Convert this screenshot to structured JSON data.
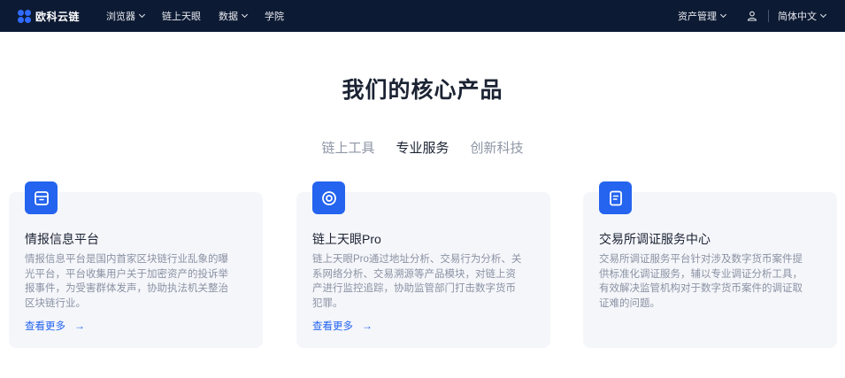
{
  "header": {
    "logo_text": "欧科云链",
    "nav": [
      {
        "label": "浏览器",
        "dropdown": true
      },
      {
        "label": "链上天眼",
        "dropdown": false
      },
      {
        "label": "数据",
        "dropdown": true
      },
      {
        "label": "学院",
        "dropdown": false
      }
    ],
    "asset_mgmt": "资产管理",
    "language": "简体中文"
  },
  "main": {
    "title": "我们的核心产品",
    "tabs": [
      {
        "label": "链上工具",
        "active": false
      },
      {
        "label": "专业服务",
        "active": true
      },
      {
        "label": "创新科技",
        "active": false
      }
    ],
    "cards": [
      {
        "icon": "archive-box-icon",
        "title": "情报信息平台",
        "desc": "情报信息平台是国内首家区块链行业乱象的曝光平台，平台收集用户关于加密资产的投诉举报事件，为受害群体发声，协助执法机关整治区块链行业。",
        "link": "查看更多"
      },
      {
        "icon": "target-eye-icon",
        "title": "链上天眼Pro",
        "desc": "链上天眼Pro通过地址分析、交易行为分析、关系网络分析、交易溯源等产品模块，对链上资产进行监控追踪，协助监管部门打击数字货币犯罪。",
        "link": "查看更多"
      },
      {
        "icon": "document-icon",
        "title": "交易所调证服务中心",
        "desc": "交易所调证服务平台针对涉及数字货币案件提供标准化调证服务，辅以专业调证分析工具，有效解决监管机构对于数字货币案件的调证取证难的问题。",
        "link": ""
      }
    ]
  },
  "colors": {
    "header_bg": "#0d1a33",
    "accent": "#2464ef",
    "card_bg": "#f5f6fa"
  }
}
